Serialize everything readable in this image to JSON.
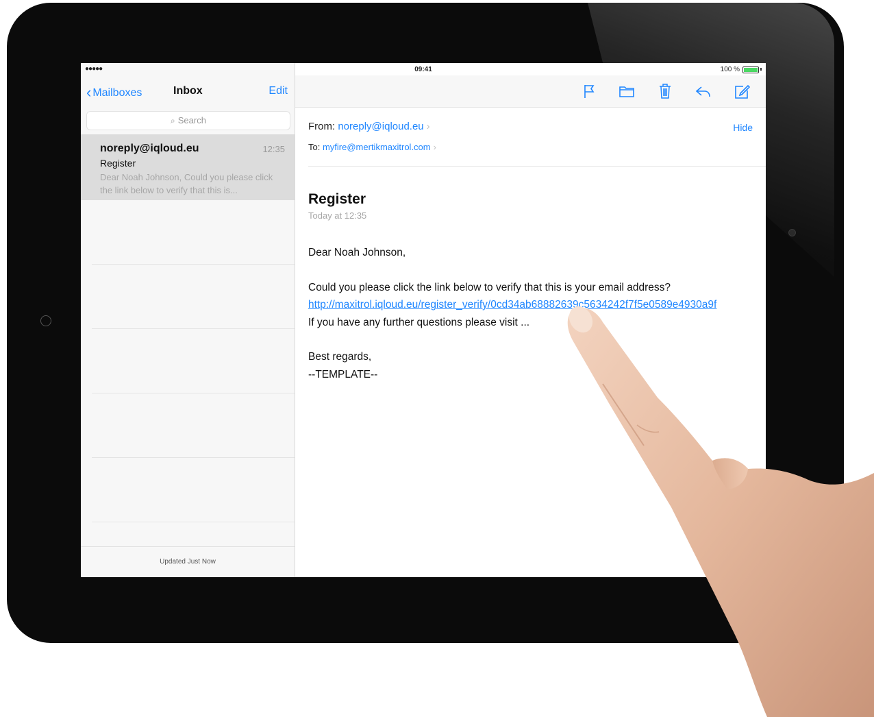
{
  "status_bar": {
    "signal": "●●●●● ",
    "time": "09:41",
    "battery_percent": "100 %"
  },
  "mailbox_list": {
    "back_label": "Mailboxes",
    "title": "Inbox",
    "edit_label": "Edit",
    "search_placeholder": "Search",
    "items": [
      {
        "sender": "noreply@iqloud.eu",
        "time": "12:35",
        "subject": "Register",
        "preview": "Dear Noah Johnson, Could you please click the link below to verify that this is..."
      }
    ],
    "footer_status": "Updated Just Now"
  },
  "toolbar": {
    "icons": [
      "flag-icon",
      "folder-icon",
      "trash-icon",
      "reply-icon",
      "compose-icon"
    ]
  },
  "message": {
    "from_label": "From:",
    "from_address": "noreply@iqloud.eu",
    "to_label": "To:",
    "to_address": "myfire@mertikmaxitrol.com",
    "hide_label": "Hide",
    "subject": "Register",
    "date": "Today at 12:35",
    "greeting": "Dear Noah Johnson,",
    "line1": "Could you please click the link below to verify that this is your email address?",
    "verify_link": "http://maxitrol.iqloud.eu/register_verify/0cd34ab68882639c5634242f7f5e0589e4930a9f",
    "line2": "If you have any further questions please visit ...",
    "signoff": "Best regards,",
    "signature": "--TEMPLATE--"
  },
  "colors": {
    "accent": "#1f86ff",
    "device_frame": "#0b0b0b",
    "selected_row": "#dcdcdc",
    "battery": "#4cd964"
  }
}
